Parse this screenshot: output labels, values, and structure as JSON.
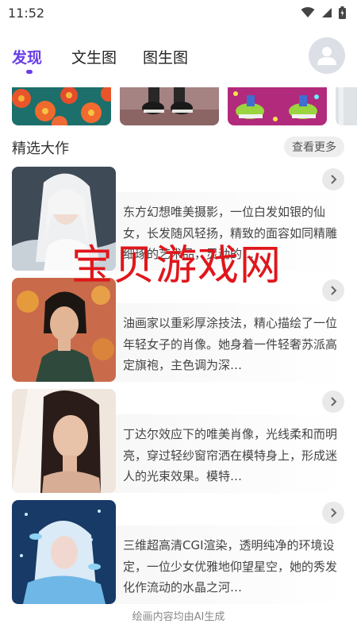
{
  "status": {
    "time": "11:52"
  },
  "tabs": [
    {
      "label": "发现"
    },
    {
      "label": "文生图"
    },
    {
      "label": "图生图"
    }
  ],
  "section": {
    "title": "精选大作",
    "see_more": "查看更多"
  },
  "cards": [
    {
      "desc": "东方幻想唯美摄影，一位白发如银的仙女，长发随风轻扬，精致的面容如同精雕细琢的艺术品，灵动的…"
    },
    {
      "desc": "油画家以重彩厚涂技法，精心描绘了一位年轻女子的肖像。她身着一件轻奢苏派高定旗袍，主色调为深…"
    },
    {
      "desc": "丁达尔效应下的唯美肖像，光线柔和而明亮，穿过轻纱窗帘洒在模特身上，形成迷人的光束效果。模特…"
    },
    {
      "desc": "三维超高清CGI渲染，透明纯净的环境设定，一位少女优雅地仰望星空，她的秀发化作流动的水晶之河…"
    }
  ],
  "watermark": "宝贝游戏网",
  "footer": {
    "text": "绘画内容均由AI生成"
  },
  "colors": {
    "accent": "#6a3de8",
    "watermark": "#e0161b"
  }
}
